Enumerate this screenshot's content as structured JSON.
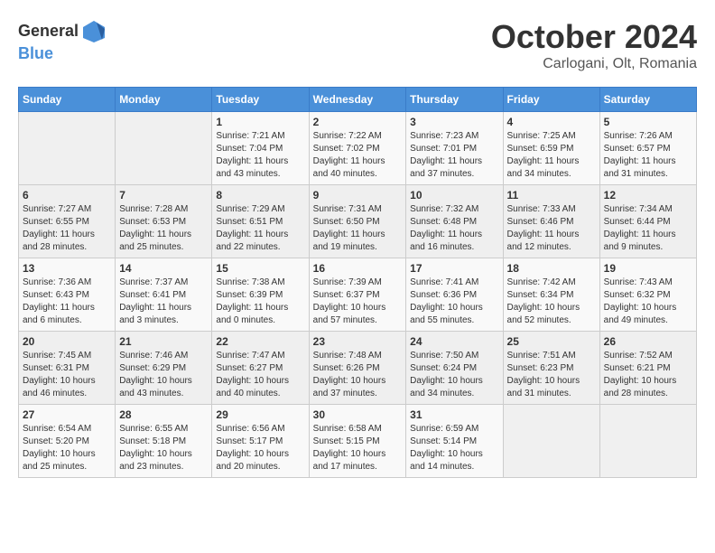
{
  "header": {
    "logo_general": "General",
    "logo_blue": "Blue",
    "month": "October 2024",
    "location": "Carlogani, Olt, Romania"
  },
  "weekdays": [
    "Sunday",
    "Monday",
    "Tuesday",
    "Wednesday",
    "Thursday",
    "Friday",
    "Saturday"
  ],
  "weeks": [
    [
      {
        "day": "",
        "sunrise": "",
        "sunset": "",
        "daylight": ""
      },
      {
        "day": "",
        "sunrise": "",
        "sunset": "",
        "daylight": ""
      },
      {
        "day": "1",
        "sunrise": "Sunrise: 7:21 AM",
        "sunset": "Sunset: 7:04 PM",
        "daylight": "Daylight: 11 hours and 43 minutes."
      },
      {
        "day": "2",
        "sunrise": "Sunrise: 7:22 AM",
        "sunset": "Sunset: 7:02 PM",
        "daylight": "Daylight: 11 hours and 40 minutes."
      },
      {
        "day": "3",
        "sunrise": "Sunrise: 7:23 AM",
        "sunset": "Sunset: 7:01 PM",
        "daylight": "Daylight: 11 hours and 37 minutes."
      },
      {
        "day": "4",
        "sunrise": "Sunrise: 7:25 AM",
        "sunset": "Sunset: 6:59 PM",
        "daylight": "Daylight: 11 hours and 34 minutes."
      },
      {
        "day": "5",
        "sunrise": "Sunrise: 7:26 AM",
        "sunset": "Sunset: 6:57 PM",
        "daylight": "Daylight: 11 hours and 31 minutes."
      }
    ],
    [
      {
        "day": "6",
        "sunrise": "Sunrise: 7:27 AM",
        "sunset": "Sunset: 6:55 PM",
        "daylight": "Daylight: 11 hours and 28 minutes."
      },
      {
        "day": "7",
        "sunrise": "Sunrise: 7:28 AM",
        "sunset": "Sunset: 6:53 PM",
        "daylight": "Daylight: 11 hours and 25 minutes."
      },
      {
        "day": "8",
        "sunrise": "Sunrise: 7:29 AM",
        "sunset": "Sunset: 6:51 PM",
        "daylight": "Daylight: 11 hours and 22 minutes."
      },
      {
        "day": "9",
        "sunrise": "Sunrise: 7:31 AM",
        "sunset": "Sunset: 6:50 PM",
        "daylight": "Daylight: 11 hours and 19 minutes."
      },
      {
        "day": "10",
        "sunrise": "Sunrise: 7:32 AM",
        "sunset": "Sunset: 6:48 PM",
        "daylight": "Daylight: 11 hours and 16 minutes."
      },
      {
        "day": "11",
        "sunrise": "Sunrise: 7:33 AM",
        "sunset": "Sunset: 6:46 PM",
        "daylight": "Daylight: 11 hours and 12 minutes."
      },
      {
        "day": "12",
        "sunrise": "Sunrise: 7:34 AM",
        "sunset": "Sunset: 6:44 PM",
        "daylight": "Daylight: 11 hours and 9 minutes."
      }
    ],
    [
      {
        "day": "13",
        "sunrise": "Sunrise: 7:36 AM",
        "sunset": "Sunset: 6:43 PM",
        "daylight": "Daylight: 11 hours and 6 minutes."
      },
      {
        "day": "14",
        "sunrise": "Sunrise: 7:37 AM",
        "sunset": "Sunset: 6:41 PM",
        "daylight": "Daylight: 11 hours and 3 minutes."
      },
      {
        "day": "15",
        "sunrise": "Sunrise: 7:38 AM",
        "sunset": "Sunset: 6:39 PM",
        "daylight": "Daylight: 11 hours and 0 minutes."
      },
      {
        "day": "16",
        "sunrise": "Sunrise: 7:39 AM",
        "sunset": "Sunset: 6:37 PM",
        "daylight": "Daylight: 10 hours and 57 minutes."
      },
      {
        "day": "17",
        "sunrise": "Sunrise: 7:41 AM",
        "sunset": "Sunset: 6:36 PM",
        "daylight": "Daylight: 10 hours and 55 minutes."
      },
      {
        "day": "18",
        "sunrise": "Sunrise: 7:42 AM",
        "sunset": "Sunset: 6:34 PM",
        "daylight": "Daylight: 10 hours and 52 minutes."
      },
      {
        "day": "19",
        "sunrise": "Sunrise: 7:43 AM",
        "sunset": "Sunset: 6:32 PM",
        "daylight": "Daylight: 10 hours and 49 minutes."
      }
    ],
    [
      {
        "day": "20",
        "sunrise": "Sunrise: 7:45 AM",
        "sunset": "Sunset: 6:31 PM",
        "daylight": "Daylight: 10 hours and 46 minutes."
      },
      {
        "day": "21",
        "sunrise": "Sunrise: 7:46 AM",
        "sunset": "Sunset: 6:29 PM",
        "daylight": "Daylight: 10 hours and 43 minutes."
      },
      {
        "day": "22",
        "sunrise": "Sunrise: 7:47 AM",
        "sunset": "Sunset: 6:27 PM",
        "daylight": "Daylight: 10 hours and 40 minutes."
      },
      {
        "day": "23",
        "sunrise": "Sunrise: 7:48 AM",
        "sunset": "Sunset: 6:26 PM",
        "daylight": "Daylight: 10 hours and 37 minutes."
      },
      {
        "day": "24",
        "sunrise": "Sunrise: 7:50 AM",
        "sunset": "Sunset: 6:24 PM",
        "daylight": "Daylight: 10 hours and 34 minutes."
      },
      {
        "day": "25",
        "sunrise": "Sunrise: 7:51 AM",
        "sunset": "Sunset: 6:23 PM",
        "daylight": "Daylight: 10 hours and 31 minutes."
      },
      {
        "day": "26",
        "sunrise": "Sunrise: 7:52 AM",
        "sunset": "Sunset: 6:21 PM",
        "daylight": "Daylight: 10 hours and 28 minutes."
      }
    ],
    [
      {
        "day": "27",
        "sunrise": "Sunrise: 6:54 AM",
        "sunset": "Sunset: 5:20 PM",
        "daylight": "Daylight: 10 hours and 25 minutes."
      },
      {
        "day": "28",
        "sunrise": "Sunrise: 6:55 AM",
        "sunset": "Sunset: 5:18 PM",
        "daylight": "Daylight: 10 hours and 23 minutes."
      },
      {
        "day": "29",
        "sunrise": "Sunrise: 6:56 AM",
        "sunset": "Sunset: 5:17 PM",
        "daylight": "Daylight: 10 hours and 20 minutes."
      },
      {
        "day": "30",
        "sunrise": "Sunrise: 6:58 AM",
        "sunset": "Sunset: 5:15 PM",
        "daylight": "Daylight: 10 hours and 17 minutes."
      },
      {
        "day": "31",
        "sunrise": "Sunrise: 6:59 AM",
        "sunset": "Sunset: 5:14 PM",
        "daylight": "Daylight: 10 hours and 14 minutes."
      },
      {
        "day": "",
        "sunrise": "",
        "sunset": "",
        "daylight": ""
      },
      {
        "day": "",
        "sunrise": "",
        "sunset": "",
        "daylight": ""
      }
    ]
  ]
}
